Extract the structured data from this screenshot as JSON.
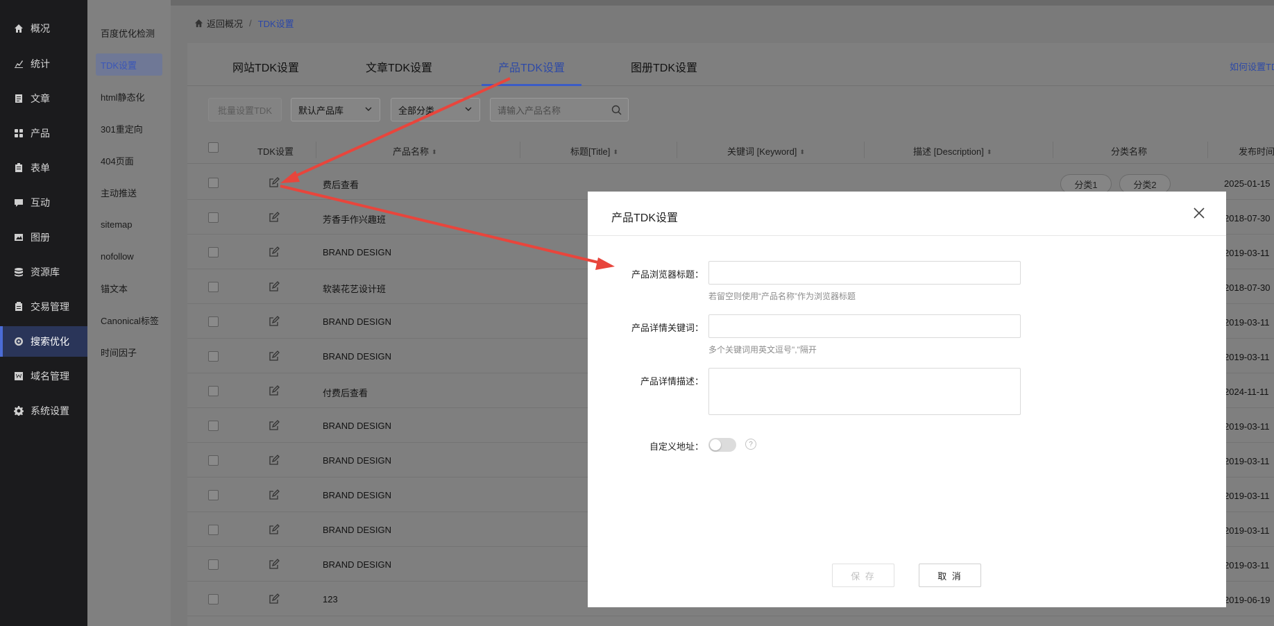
{
  "nav": {
    "items": [
      {
        "label": "概况",
        "icon": "home-icon"
      },
      {
        "label": "统计",
        "icon": "stats-icon"
      },
      {
        "label": "文章",
        "icon": "article-icon"
      },
      {
        "label": "产品",
        "icon": "product-icon"
      },
      {
        "label": "表单",
        "icon": "form-icon"
      },
      {
        "label": "互动",
        "icon": "chat-icon"
      },
      {
        "label": "图册",
        "icon": "gallery-icon"
      },
      {
        "label": "资源库",
        "icon": "database-icon"
      },
      {
        "label": "交易管理",
        "icon": "trade-icon"
      },
      {
        "label": "搜索优化",
        "icon": "seo-icon"
      },
      {
        "label": "域名管理",
        "icon": "domain-icon"
      },
      {
        "label": "系统设置",
        "icon": "gear-icon"
      }
    ]
  },
  "subnav": {
    "items": [
      {
        "label": "百度优化检测"
      },
      {
        "label": "TDK设置"
      },
      {
        "label": "html静态化"
      },
      {
        "label": "301重定向"
      },
      {
        "label": "404页面"
      },
      {
        "label": "主动推送"
      },
      {
        "label": "sitemap"
      },
      {
        "label": "nofollow"
      },
      {
        "label": "锚文本"
      },
      {
        "label": "Canonical标签"
      },
      {
        "label": "时间因子"
      }
    ]
  },
  "breadcrumb": {
    "back": "返回概况",
    "sep": "/",
    "current": "TDK设置"
  },
  "tabs": [
    {
      "label": "网站TDK设置"
    },
    {
      "label": "文章TDK设置"
    },
    {
      "label": "产品TDK设置"
    },
    {
      "label": "图册TDK设置"
    }
  ],
  "help_link": "如何设置TD",
  "toolbar": {
    "batch": "批量设置TDK",
    "lib_select": "默认产品库",
    "cat_select": "全部分类",
    "search_placeholder": "请输入产品名称"
  },
  "table": {
    "headers": [
      "TDK设置",
      "产品名称",
      "标题[Title]",
      "关键词 [Keyword]",
      "描述 [Description]",
      "分类名称",
      "发布时间"
    ],
    "sort_glyph": "⬍",
    "rows": [
      {
        "name": "费后查看",
        "date": "2025-01-15"
      },
      {
        "name": "芳香手作兴趣班",
        "date": "2018-07-30"
      },
      {
        "name": "BRAND DESIGN",
        "date": "2019-03-11"
      },
      {
        "name": "软装花艺设计班",
        "date": "2018-07-30"
      },
      {
        "name": "BRAND DESIGN",
        "date": "2019-03-11"
      },
      {
        "name": "BRAND DESIGN",
        "date": "2019-03-11"
      },
      {
        "name": "付费后查看",
        "date": "2024-11-11"
      },
      {
        "name": "BRAND DESIGN",
        "date": "2019-03-11"
      },
      {
        "name": "BRAND DESIGN",
        "date": "2019-03-11"
      },
      {
        "name": "BRAND DESIGN",
        "date": "2019-03-11"
      },
      {
        "name": "BRAND DESIGN",
        "date": "2019-03-11"
      },
      {
        "name": "BRAND DESIGN",
        "date": "2019-03-11"
      },
      {
        "name": "123",
        "date": "2019-06-19"
      }
    ],
    "first_row_tags": [
      "分类1",
      "分类2"
    ]
  },
  "modal": {
    "title": "产品TDK设置",
    "title_label": "产品浏览器标题：",
    "title_value": "",
    "title_hint": "若留空则使用“产品名称”作为浏览器标题",
    "keyword_label": "产品详情关键词：",
    "keyword_value": "",
    "keyword_hint": "多个关键词用英文逗号\",\"隔开",
    "desc_label": "产品详情描述：",
    "desc_value": "",
    "custom_url_label": "自定义地址：",
    "custom_url_enabled": false,
    "help_glyph": "?",
    "save": "保 存",
    "cancel": "取 消"
  },
  "colors": {
    "accent": "#3b5cc6",
    "annotation": "#e8453c"
  }
}
